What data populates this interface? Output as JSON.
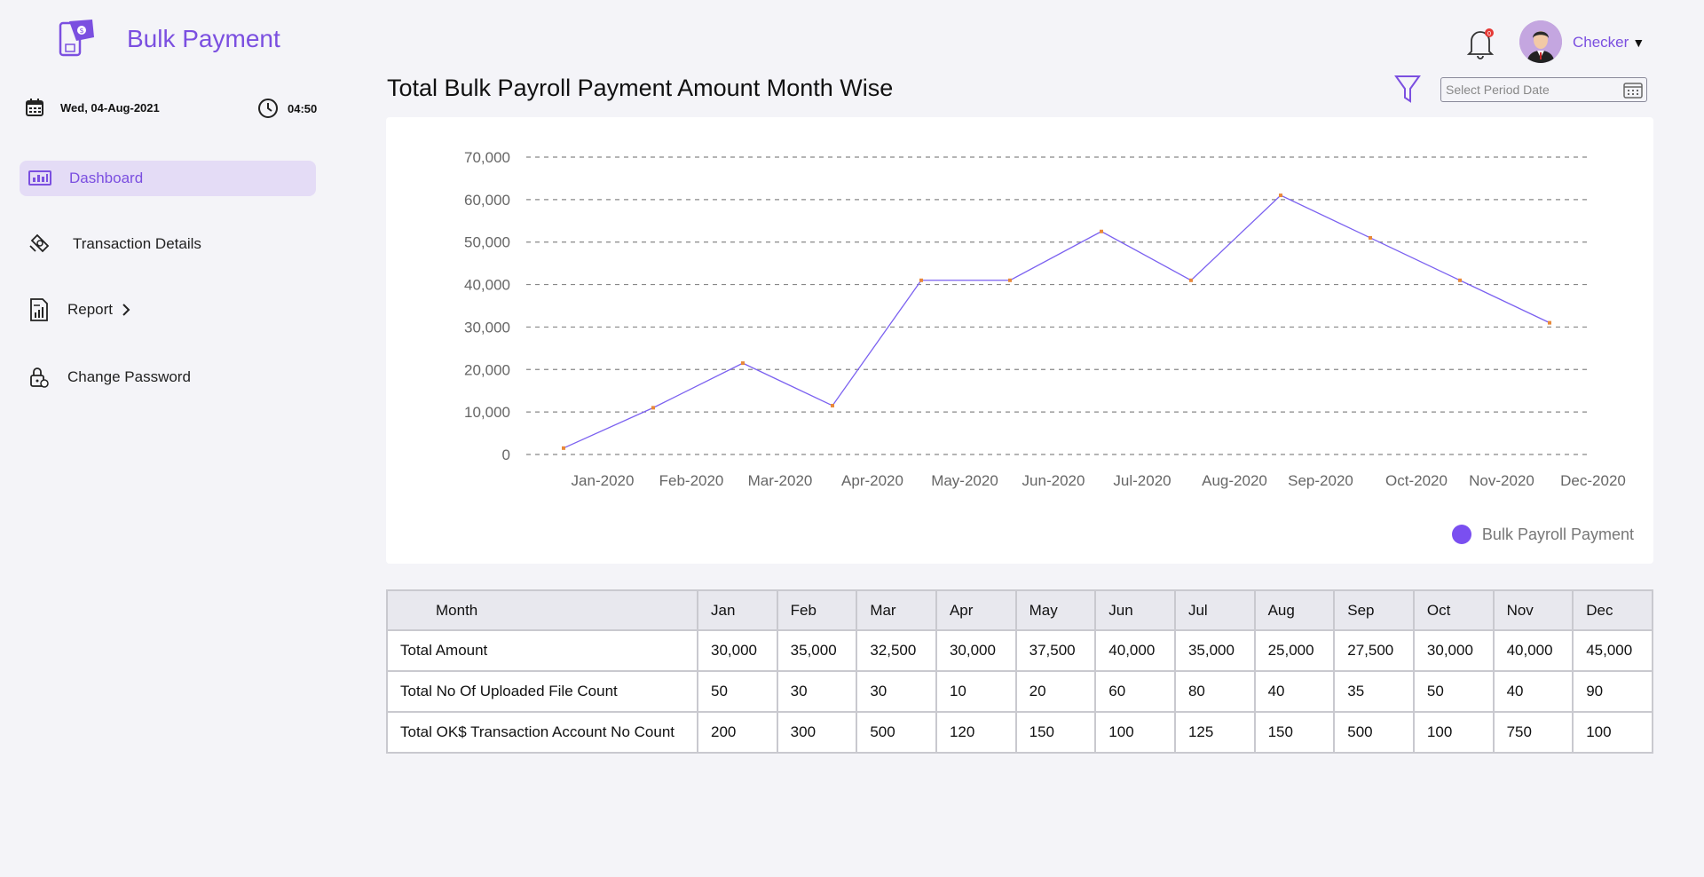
{
  "app": {
    "title": "Bulk Payment",
    "brand_color": "#7b4fe0",
    "logo_icon": "wallet-phone-icon"
  },
  "datetime": {
    "date": "Wed, 04-Aug-2021",
    "time": "04:50"
  },
  "sidebar": {
    "items": [
      {
        "label": "Dashboard",
        "icon": "dashboard-icon",
        "active": true
      },
      {
        "label": "Transaction Details",
        "icon": "transaction-icon"
      },
      {
        "label": "Report",
        "icon": "report-icon",
        "has_submenu": true
      },
      {
        "label": "Change Password",
        "icon": "lock-icon"
      }
    ]
  },
  "header": {
    "notification_badge": "0",
    "user_name": "Checker"
  },
  "page": {
    "title": "Total Bulk Payroll Payment Amount Month Wise",
    "date_placeholder": "Select Period Date"
  },
  "chart_data": {
    "type": "line",
    "title": "",
    "xlabel": "",
    "ylabel": "",
    "categories": [
      "Jan-2020",
      "Feb-2020",
      "Mar-2020",
      "Apr-2020",
      "May-2020",
      "Jun-2020",
      "Jul-2020",
      "Aug-2020",
      "Sep-2020",
      "Oct-2020",
      "Nov-2020",
      "Dec-2020"
    ],
    "series": [
      {
        "name": "Bulk Payroll Payment",
        "color": "#7b61f0",
        "marker_color": "#e8893a",
        "values": [
          1500,
          11000,
          21500,
          11500,
          41000,
          41000,
          52500,
          41000,
          61000,
          51000,
          41000,
          31000
        ]
      }
    ],
    "ylim": [
      0,
      70000
    ],
    "yticks": [
      "0",
      "10,000",
      "20,000",
      "30,000",
      "40,000",
      "50,000",
      "60,000",
      "70,000"
    ],
    "grid": true,
    "legend_position": "bottom-right",
    "legend_dot_color": "#7a4ff0"
  },
  "table": {
    "headers": [
      "Month",
      "Jan",
      "Feb",
      "Mar",
      "Apr",
      "May",
      "Jun",
      "Jul",
      "Aug",
      "Sep",
      "Oct",
      "Nov",
      "Dec"
    ],
    "rows": [
      [
        "Total Amount",
        "30,000",
        "35,000",
        "32,500",
        "30,000",
        "37,500",
        "40,000",
        "35,000",
        "25,000",
        "27,500",
        "30,000",
        "40,000",
        "45,000"
      ],
      [
        "Total No Of Uploaded File Count",
        "50",
        "30",
        "30",
        "10",
        "20",
        "60",
        "80",
        "40",
        "35",
        "50",
        "40",
        "90"
      ],
      [
        "Total OK$ Transaction Account No Count",
        "200",
        "300",
        "500",
        "120",
        "150",
        "100",
        "125",
        "150",
        "500",
        "100",
        "750",
        "100"
      ]
    ]
  }
}
